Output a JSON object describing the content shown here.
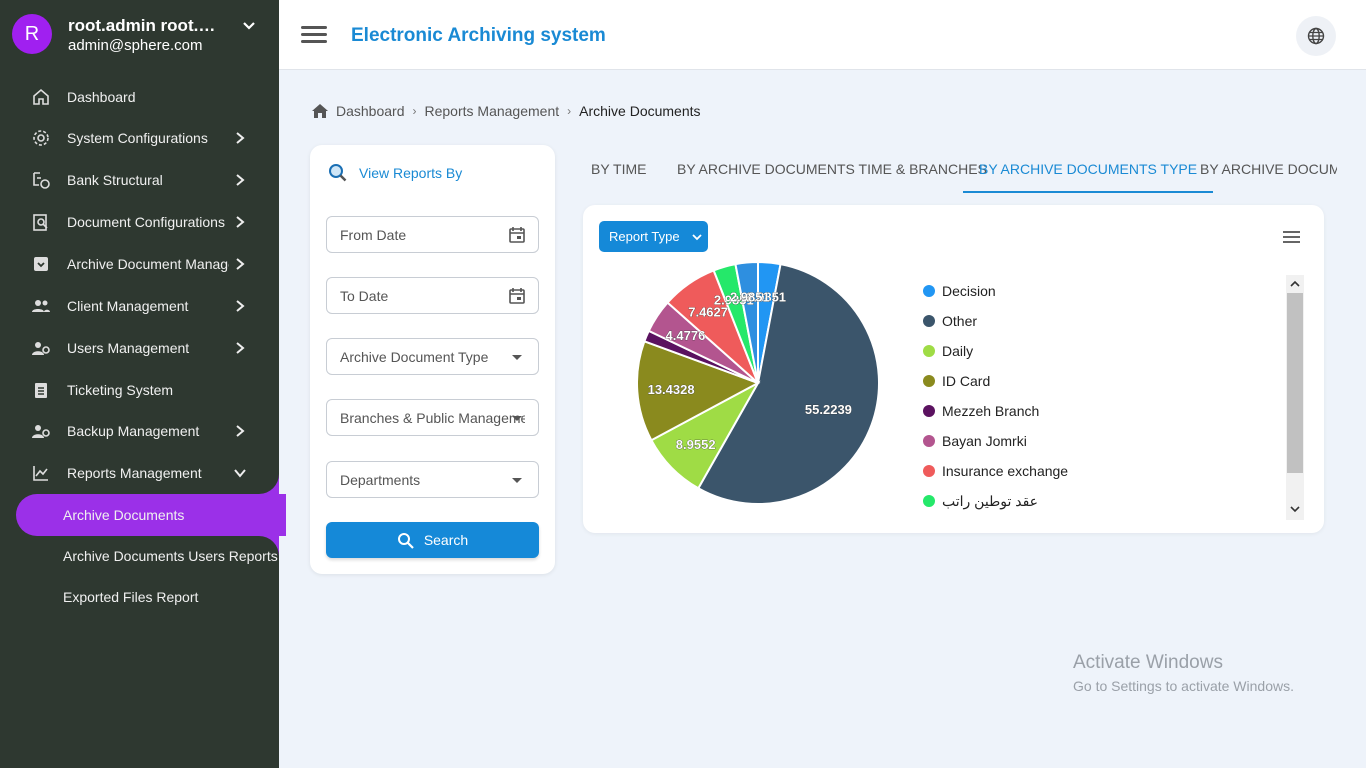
{
  "profile": {
    "initial": "R",
    "name": "root.admin root.a...",
    "email": "admin@sphere.com"
  },
  "sidebar": {
    "items": [
      {
        "label": "Dashboard",
        "icon": "home-icon",
        "has_children": false
      },
      {
        "label": "System Configurations",
        "icon": "gear-icon",
        "has_children": true
      },
      {
        "label": "Bank Structural",
        "icon": "bank-structure-icon",
        "has_children": true
      },
      {
        "label": "Document Configurations",
        "icon": "document-search-icon",
        "has_children": true
      },
      {
        "label": "Archive Document Management",
        "icon": "archive-box-icon",
        "has_children": true
      },
      {
        "label": "Client Management",
        "icon": "clients-icon",
        "has_children": true
      },
      {
        "label": "Users Management",
        "icon": "users-gear-icon",
        "has_children": true
      },
      {
        "label": "Ticketing System",
        "icon": "clipboard-icon",
        "has_children": false
      },
      {
        "label": "Backup Management",
        "icon": "backup-gear-icon",
        "has_children": true
      },
      {
        "label": "Reports Management",
        "icon": "chart-line-icon",
        "has_children": true,
        "expanded": true
      }
    ],
    "sub_items": [
      {
        "label": "Archive Documents",
        "active": true
      },
      {
        "label": "Archive Documents Users Reports",
        "active": false
      },
      {
        "label": "Exported Files Report",
        "active": false
      }
    ]
  },
  "topbar": {
    "title": "Electronic Archiving system"
  },
  "breadcrumb": {
    "home": "Dashboard",
    "parent": "Reports Management",
    "current": "Archive Documents"
  },
  "filters": {
    "heading": "View Reports By",
    "from_date": "From Date",
    "to_date": "To Date",
    "doc_type": "Archive Document Type",
    "branches": "Branches & Public Management",
    "departments": "Departments",
    "search_label": "Search"
  },
  "tabs": [
    {
      "label": "BY TIME",
      "active": false
    },
    {
      "label": "BY ARCHIVE DOCUMENTS TIME & BRANCHES",
      "active": false
    },
    {
      "label": "BY ARCHIVE DOCUMENTS TYPE",
      "active": true
    },
    {
      "label": "BY ARCHIVE DOCUMENTS",
      "active": false
    }
  ],
  "report_type_label": "Report Type",
  "chart_data": {
    "type": "pie",
    "slices": [
      {
        "name": "Decision",
        "value": 2.9851,
        "color": "#2196f3",
        "label": "2.9851"
      },
      {
        "name": "Other",
        "value": 55.2239,
        "color": "#3b556b",
        "label": "55.2239"
      },
      {
        "name": "Daily",
        "value": 8.9552,
        "color": "#9fdc45",
        "label": "8.9552"
      },
      {
        "name": "ID Card",
        "value": 13.4328,
        "color": "#8a8a1e",
        "label": "13.4328"
      },
      {
        "name": "Mezzeh Branch",
        "value": 1.4925,
        "color": "#5b1260",
        "label": ""
      },
      {
        "name": "Bayan Jomrki",
        "value": 4.4776,
        "color": "#b3558f",
        "label": "4.4776"
      },
      {
        "name": "Insurance exchange",
        "value": 7.4627,
        "color": "#ef5b5b",
        "label": "7.4627"
      },
      {
        "name": "عقد توطين راتب",
        "value": 2.9851,
        "color": "#25e86a",
        "label": "2.9851"
      },
      {
        "name": "",
        "value": 2.9851,
        "color": "#2e8fe0",
        "label": "2.9851"
      }
    ]
  },
  "watermark": {
    "line1": "Activate Windows",
    "line2": "Go to Settings to activate Windows."
  }
}
